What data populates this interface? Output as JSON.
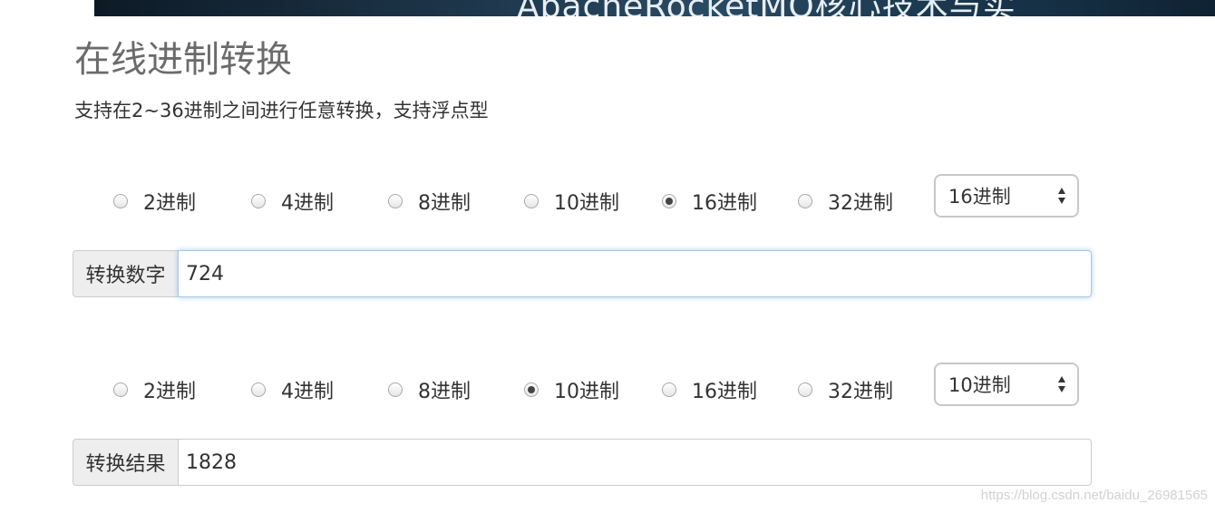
{
  "banner": {
    "text": "ApacheRocketMQ核心技术与实"
  },
  "header": {
    "title": "在线进制转换",
    "subtitle": "支持在2~36进制之间进行任意转换，支持浮点型"
  },
  "source": {
    "radios": [
      {
        "label": "2进制",
        "checked": false
      },
      {
        "label": "4进制",
        "checked": false
      },
      {
        "label": "8进制",
        "checked": false
      },
      {
        "label": "10进制",
        "checked": false
      },
      {
        "label": "16进制",
        "checked": true
      },
      {
        "label": "32进制",
        "checked": false
      }
    ],
    "select_value": "16进制",
    "input_label": "转换数字",
    "input_value": "724"
  },
  "target": {
    "radios": [
      {
        "label": "2进制",
        "checked": false
      },
      {
        "label": "4进制",
        "checked": false
      },
      {
        "label": "8进制",
        "checked": false
      },
      {
        "label": "10进制",
        "checked": true
      },
      {
        "label": "16进制",
        "checked": false
      },
      {
        "label": "32进制",
        "checked": false
      }
    ],
    "select_value": "10进制",
    "input_label": "转换结果",
    "input_value": "1828"
  },
  "watermark": "https://blog.csdn.net/baidu_26981565"
}
